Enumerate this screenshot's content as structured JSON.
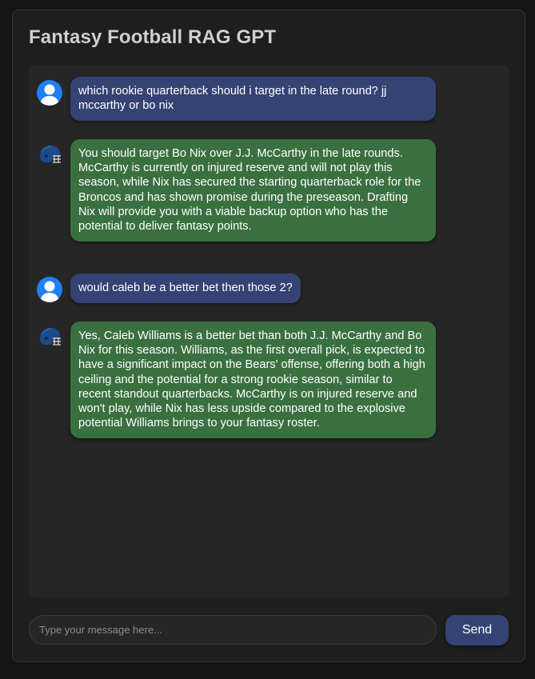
{
  "app": {
    "title": "Fantasy Football RAG GPT"
  },
  "icons": {
    "user_avatar": "user-avatar-icon",
    "bot_avatar": "football-helmet-icon"
  },
  "colors": {
    "user_bubble": "#344373",
    "bot_bubble": "#3a7040",
    "user_avatar": "#1f7ff3",
    "send_button": "#344373"
  },
  "messages": [
    {
      "role": "user",
      "text": "which rookie quarterback should i target in the late round? jj mccarthy or bo nix"
    },
    {
      "role": "assistant",
      "text": "You should target Bo Nix over J.J. McCarthy in the late rounds. McCarthy is currently on injured reserve and will not play this season, while Nix has secured the starting quarterback role for the Broncos and has shown promise during the preseason. Drafting Nix will provide you with a viable backup option who has the potential to deliver fantasy points."
    },
    {
      "role": "user",
      "text": "would caleb be a better bet then those 2?"
    },
    {
      "role": "assistant",
      "text": "Yes, Caleb Williams is a better bet than both J.J. McCarthy and Bo Nix for this season. Williams, as the first overall pick, is expected to have a significant impact on the Bears' offense, offering both a high ceiling and the potential for a strong rookie season, similar to recent standout quarterbacks. McCarthy is on injured reserve and won't play, while Nix has less upside compared to the explosive potential Williams brings to your fantasy roster."
    }
  ],
  "input": {
    "placeholder": "Type your message here...",
    "value": ""
  },
  "send_button": {
    "label": "Send"
  }
}
